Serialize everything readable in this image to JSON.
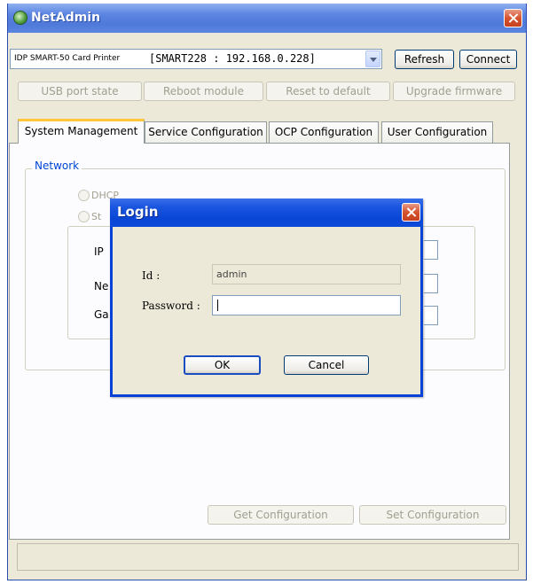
{
  "window": {
    "title": "NetAdmin"
  },
  "printer": {
    "name": "IDP SMART-50 Card Printer",
    "address": "[SMART228 : 192.168.0.228]"
  },
  "top_buttons": {
    "refresh": "Refresh",
    "connect": "Connect"
  },
  "actions": {
    "usb": "USB port state",
    "reboot": "Reboot module",
    "reset": "Reset to default",
    "upgrade": "Upgrade firmware"
  },
  "tabs": [
    {
      "label": "System Management",
      "active": true
    },
    {
      "label": "Service Configuration",
      "active": false
    },
    {
      "label": "OCP Configuration",
      "active": false
    },
    {
      "label": "User Configuration",
      "active": false
    }
  ],
  "network": {
    "group_label": "Network",
    "dhcp": "DHCP",
    "static_partial": "St",
    "ip_partial": "IP",
    "netmask_partial": "Ne",
    "gateway_partial": "Ga"
  },
  "bottom_buttons": {
    "get": "Get Configuration",
    "set": "Set Configuration"
  },
  "login": {
    "title": "Login",
    "id_label": "Id :",
    "id_value": "admin",
    "password_label": "Password :",
    "password_value": "",
    "ok": "OK",
    "cancel": "Cancel"
  },
  "colors": {
    "titlebar": "#5d86e2",
    "dialog_titlebar": "#0a46d6",
    "group_label": "#0046d5",
    "active_tab_accent": "#ffc83c"
  }
}
